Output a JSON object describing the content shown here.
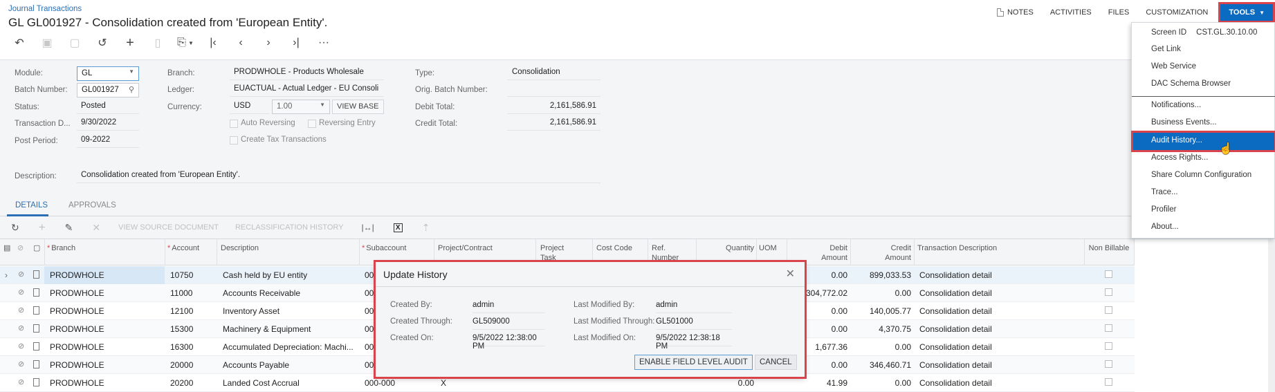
{
  "header": {
    "breadcrumb": "Journal Transactions",
    "title": "GL GL001927 - Consolidation created from 'European Entity'."
  },
  "toolbar": {
    "icons": [
      "back-icon",
      "save-close-icon",
      "save-icon",
      "undo-icon",
      "add-icon",
      "delete-icon",
      "copy-paste-icon",
      "first-icon",
      "previous-icon",
      "next-icon",
      "last-icon",
      "more-icon"
    ]
  },
  "top_actions": {
    "notes": "NOTES",
    "activities": "ACTIVITIES",
    "files": "FILES",
    "customization": "CUSTOMIZATION",
    "tools": "TOOLS"
  },
  "form": {
    "module_label": "Module:",
    "module_value": "GL",
    "batch_label": "Batch Number:",
    "batch_value": "GL001927",
    "status_label": "Status:",
    "status_value": "Posted",
    "trandate_label": "Transaction D...",
    "trandate_value": "9/30/2022",
    "period_label": "Post Period:",
    "period_value": "09-2022",
    "branch_label": "Branch:",
    "branch_value": "PRODWHOLE - Products Wholesale",
    "ledger_label": "Ledger:",
    "ledger_value": "EUACTUAL - Actual Ledger - EU Consoli",
    "currency_label": "Currency:",
    "currency_value": "USD",
    "rate_value": "1.00",
    "view_base": "VIEW BASE",
    "auto_reversing": "Auto Reversing",
    "reversing_entry": "Reversing Entry",
    "create_tax": "Create Tax Transactions",
    "type_label": "Type:",
    "type_value": "Consolidation",
    "orig_batch_label": "Orig. Batch Number:",
    "orig_batch_value": "",
    "debit_total_label": "Debit Total:",
    "debit_total_value": "2,161,586.91",
    "credit_total_label": "Credit Total:",
    "credit_total_value": "2,161,586.91",
    "description_label": "Description:",
    "description_value": "Consolidation created from 'European Entity'."
  },
  "tabs": [
    {
      "label": "DETAILS",
      "active": true
    },
    {
      "label": "APPROVALS",
      "active": false
    }
  ],
  "grid_toolbar": {
    "view_source": "VIEW SOURCE DOCUMENT",
    "reclass_history": "RECLASSIFICATION HISTORY"
  },
  "grid": {
    "columns": {
      "branch": "Branch",
      "account": "Account",
      "description": "Description",
      "subaccount": "Subaccount",
      "project": "Project/Contract",
      "project_task": "Project Task",
      "cost_code": "Cost Code",
      "ref_number": "Ref. Number",
      "quantity": "Quantity",
      "uom": "UOM",
      "debit": "Debit Amount",
      "credit": "Credit Amount",
      "tran_desc": "Transaction Description",
      "non_billable": "Non Billable"
    },
    "rows": [
      {
        "branch": "PRODWHOLE",
        "account": "10750",
        "description": "Cash held by EU entity",
        "subaccount": "00",
        "project": "",
        "quantity": "",
        "debit": "0.00",
        "credit": "899,033.53",
        "tran_desc": "Consolidation detail"
      },
      {
        "branch": "PRODWHOLE",
        "account": "11000",
        "description": "Accounts Receivable",
        "subaccount": "00",
        "project": "",
        "quantity": "",
        "debit": "304,772.02",
        "credit": "0.00",
        "tran_desc": "Consolidation detail"
      },
      {
        "branch": "PRODWHOLE",
        "account": "12100",
        "description": "Inventory Asset",
        "subaccount": "00",
        "project": "",
        "quantity": "",
        "debit": "0.00",
        "credit": "140,005.77",
        "tran_desc": "Consolidation detail"
      },
      {
        "branch": "PRODWHOLE",
        "account": "15300",
        "description": "Machinery & Equipment",
        "subaccount": "00",
        "project": "",
        "quantity": "",
        "debit": "0.00",
        "credit": "4,370.75",
        "tran_desc": "Consolidation detail"
      },
      {
        "branch": "PRODWHOLE",
        "account": "16300",
        "description": "Accumulated Depreciation: Machi...",
        "subaccount": "00",
        "project": "",
        "quantity": "",
        "debit": "1,677.36",
        "credit": "0.00",
        "tran_desc": "Consolidation detail"
      },
      {
        "branch": "PRODWHOLE",
        "account": "20000",
        "description": "Accounts Payable",
        "subaccount": "00",
        "project": "",
        "quantity": "",
        "debit": "0.00",
        "credit": "346,460.71",
        "tran_desc": "Consolidation detail"
      },
      {
        "branch": "PRODWHOLE",
        "account": "20200",
        "description": "Landed Cost Accrual",
        "subaccount": "000-000",
        "project": "X",
        "quantity": "0.00",
        "debit": "41.99",
        "credit": "0.00",
        "tran_desc": "Consolidation detail"
      }
    ]
  },
  "dialog": {
    "title": "Update History",
    "created_by_label": "Created By:",
    "created_by_value": "admin",
    "created_through_label": "Created Through:",
    "created_through_value": "GL509000",
    "created_on_label": "Created On:",
    "created_on_value": "9/5/2022 12:38:00 PM",
    "modified_by_label": "Last Modified By:",
    "modified_by_value": "admin",
    "modified_through_label": "Last Modified Through:",
    "modified_through_value": "GL501000",
    "modified_on_label": "Last Modified On:",
    "modified_on_value": "9/5/2022 12:38:18 PM",
    "enable_audit": "ENABLE FIELD LEVEL AUDIT",
    "cancel": "CANCEL"
  },
  "tools_menu": {
    "screen_id_label": "Screen ID",
    "screen_id_value": "CST.GL.30.10.00",
    "items": [
      "Get Link",
      "Web Service",
      "DAC Schema Browser",
      "Notifications...",
      "Business Events...",
      "Audit History...",
      "Access Rights...",
      "Share Column Configuration",
      "Trace...",
      "Profiler",
      "About..."
    ],
    "highlighted": "Audit History..."
  },
  "colors": {
    "accent": "#0a6bc1",
    "highlight_outline": "#d9434c",
    "link": "#2a6fb5"
  }
}
